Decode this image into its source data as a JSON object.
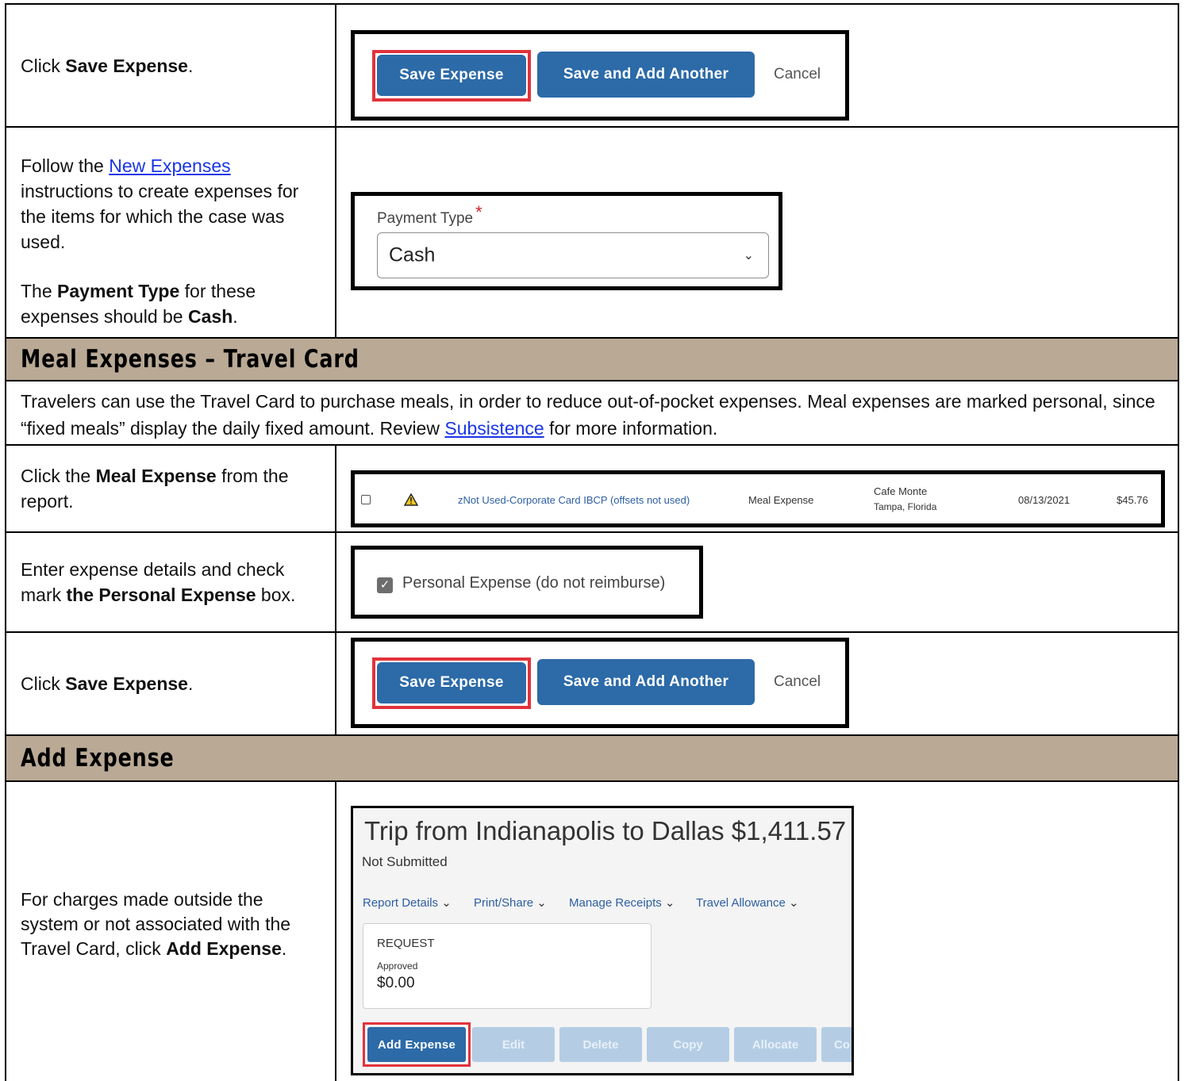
{
  "row1": {
    "instruction": {
      "prefix": "Click ",
      "bold": "Save Expense",
      "suffix": "."
    },
    "buttons": {
      "save": "Save Expense",
      "save_add": "Save and Add Another",
      "cancel": "Cancel"
    }
  },
  "row2": {
    "p1_prefix": "Follow the ",
    "p1_link": "New Expenses",
    "p1_rest": " instructions to create expenses for the items for which the case was used.",
    "p2_prefix": "The ",
    "p2_bold": "Payment Type",
    "p2_middle": " for these expenses should be ",
    "p2_bold2": "Cash",
    "p2_suffix": ".",
    "field_label": "Payment Type",
    "required_star": "*",
    "field_value": "Cash"
  },
  "section_meal": {
    "title": "Meal Expenses – Travel Card",
    "intro_prefix": "Travelers can use the Travel Card to purchase meals, in order to reduce out-of-pocket expenses. Meal expenses are marked personal, since “fixed meals” display the daily fixed amount. Review ",
    "intro_link": "Subsistence",
    "intro_suffix": " for more information."
  },
  "row3": {
    "prefix": "Click the ",
    "bold": "Meal Expense",
    "suffix": " from the report.",
    "list_row": {
      "payment": "zNot Used-Corporate Card IBCP (offsets not used)",
      "type": "Meal Expense",
      "vendor": "Cafe Monte",
      "location": "Tampa, Florida",
      "date": "08/13/2021",
      "amount": "$45.76"
    }
  },
  "row4": {
    "prefix": "Enter expense details and check mark ",
    "bold": "the Personal Expense",
    "suffix": " box.",
    "checkbox_label": "Personal Expense (do not reimburse)"
  },
  "row5": {
    "instruction": {
      "prefix": "Click ",
      "bold": "Save Expense",
      "suffix": "."
    },
    "buttons": {
      "save": "Save Expense",
      "save_add": "Save and Add Another",
      "cancel": "Cancel"
    }
  },
  "section_add": {
    "title": "Add Expense"
  },
  "row6": {
    "prefix": "For charges made outside the system or not associated with the Travel Card, click ",
    "bold": "Add Expense",
    "suffix": ".",
    "report": {
      "title": "Trip from Indianapolis to Dallas $1,411.57",
      "status": "Not Submitted",
      "menus": [
        "Report Details",
        "Print/Share",
        "Manage Receipts",
        "Travel Allowance"
      ],
      "card_title": "REQUEST",
      "card_status": "Approved",
      "card_amount": "$0.00",
      "buttons": [
        "Add Expense",
        "Edit",
        "Delete",
        "Copy",
        "Allocate",
        "Co"
      ]
    }
  }
}
